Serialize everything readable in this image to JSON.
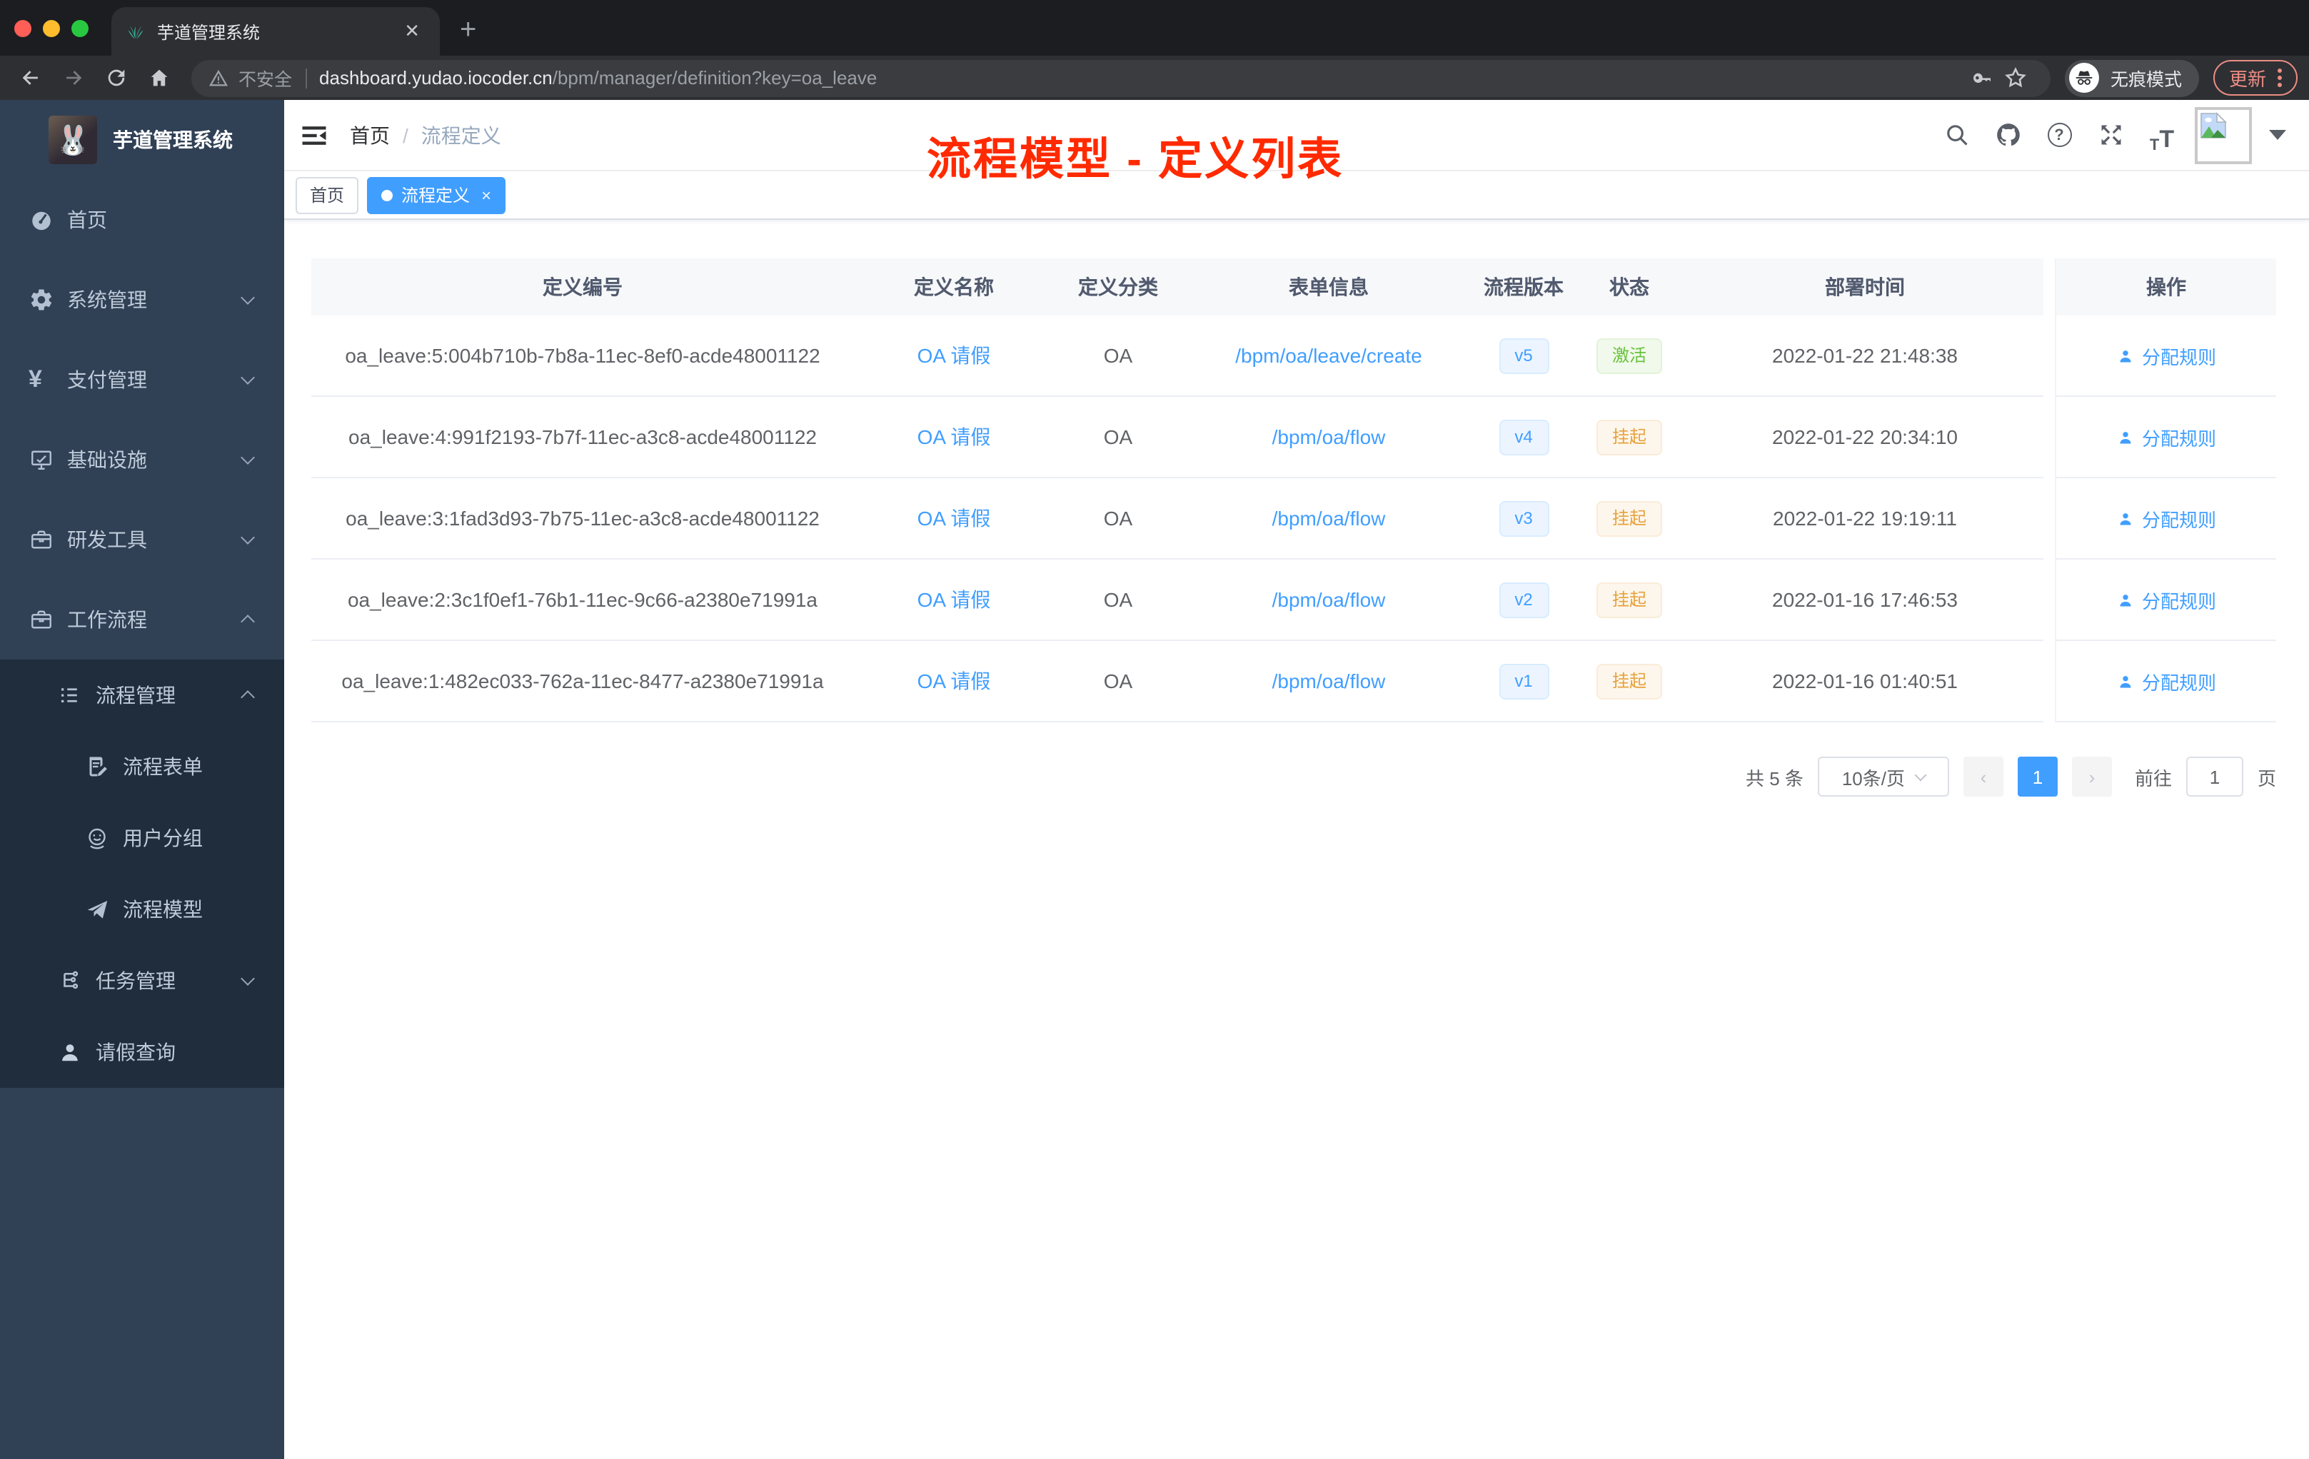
{
  "browser": {
    "tab_title": "芋道管理系统",
    "security_label": "不安全",
    "url_host": "dashboard.yudao.iocoder.cn",
    "url_path": "/bpm/manager/definition?key=oa_leave",
    "incognito_label": "无痕模式",
    "update_label": "更新"
  },
  "sidebar": {
    "logo_title": "芋道管理系统",
    "items": {
      "home": "首页",
      "system": "系统管理",
      "payment": "支付管理",
      "infra": "基础设施",
      "devtools": "研发工具",
      "workflow": "工作流程",
      "process_mgmt": "流程管理",
      "process_form": "流程表单",
      "user_group": "用户分组",
      "process_model": "流程模型",
      "task_mgmt": "任务管理",
      "leave_query": "请假查询"
    }
  },
  "navbar": {
    "breadcrumb": [
      "首页",
      "流程定义"
    ],
    "breadcrumb_separator": "/"
  },
  "annotation": {
    "text": "流程模型 - 定义列表",
    "color": "#ff2a00"
  },
  "tags": [
    {
      "label": "首页",
      "active": false
    },
    {
      "label": "流程定义",
      "active": true
    }
  ],
  "table": {
    "headers": [
      "定义编号",
      "定义名称",
      "定义分类",
      "表单信息",
      "流程版本",
      "状态",
      "部署时间",
      "操作"
    ],
    "rows": [
      {
        "id": "oa_leave:5:004b710b-7b8a-11ec-8ef0-acde48001122",
        "name": "OA 请假",
        "category": "OA",
        "form": "/bpm/oa/leave/create",
        "version": "v5",
        "status": "激活",
        "status_type": "success",
        "deploy_time": "2022-01-22 21:48:38",
        "action": "分配规则"
      },
      {
        "id": "oa_leave:4:991f2193-7b7f-11ec-a3c8-acde48001122",
        "name": "OA 请假",
        "category": "OA",
        "form": "/bpm/oa/flow",
        "version": "v4",
        "status": "挂起",
        "status_type": "warning",
        "deploy_time": "2022-01-22 20:34:10",
        "action": "分配规则"
      },
      {
        "id": "oa_leave:3:1fad3d93-7b75-11ec-a3c8-acde48001122",
        "name": "OA 请假",
        "category": "OA",
        "form": "/bpm/oa/flow",
        "version": "v3",
        "status": "挂起",
        "status_type": "warning",
        "deploy_time": "2022-01-22 19:19:11",
        "action": "分配规则"
      },
      {
        "id": "oa_leave:2:3c1f0ef1-76b1-11ec-9c66-a2380e71991a",
        "name": "OA 请假",
        "category": "OA",
        "form": "/bpm/oa/flow",
        "version": "v2",
        "status": "挂起",
        "status_type": "warning",
        "deploy_time": "2022-01-16 17:46:53",
        "action": "分配规则"
      },
      {
        "id": "oa_leave:1:482ec033-762a-11ec-8477-a2380e71991a",
        "name": "OA 请假",
        "category": "OA",
        "form": "/bpm/oa/flow",
        "version": "v1",
        "status": "挂起",
        "status_type": "warning",
        "deploy_time": "2022-01-16 01:40:51",
        "action": "分配规则"
      }
    ]
  },
  "pagination": {
    "total_label": "共 5 条",
    "page_size_label": "10条/页",
    "current_page": "1",
    "goto_label": "前往",
    "goto_value": "1",
    "page_unit_label": "页"
  },
  "colors": {
    "accent": "#409eff",
    "success": "#67c23a",
    "warning": "#e6a23c",
    "annotation_red": "#ff2a00",
    "sidebar_bg": "#304156",
    "submenu_bg": "#1f2d3d"
  }
}
